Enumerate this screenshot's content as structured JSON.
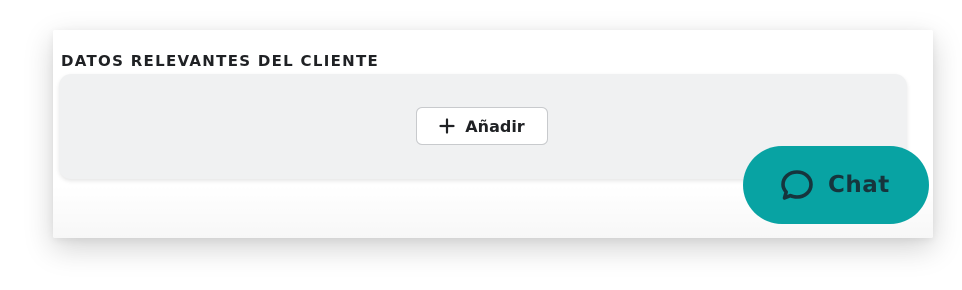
{
  "section": {
    "title": "DATOS RELEVANTES DEL CLIENTE"
  },
  "panel": {
    "add_label": "Añadir",
    "add_icon": "plus-icon"
  },
  "chat": {
    "label": "Chat",
    "icon": "chat-bubble-icon",
    "color": "#08a3a3"
  }
}
